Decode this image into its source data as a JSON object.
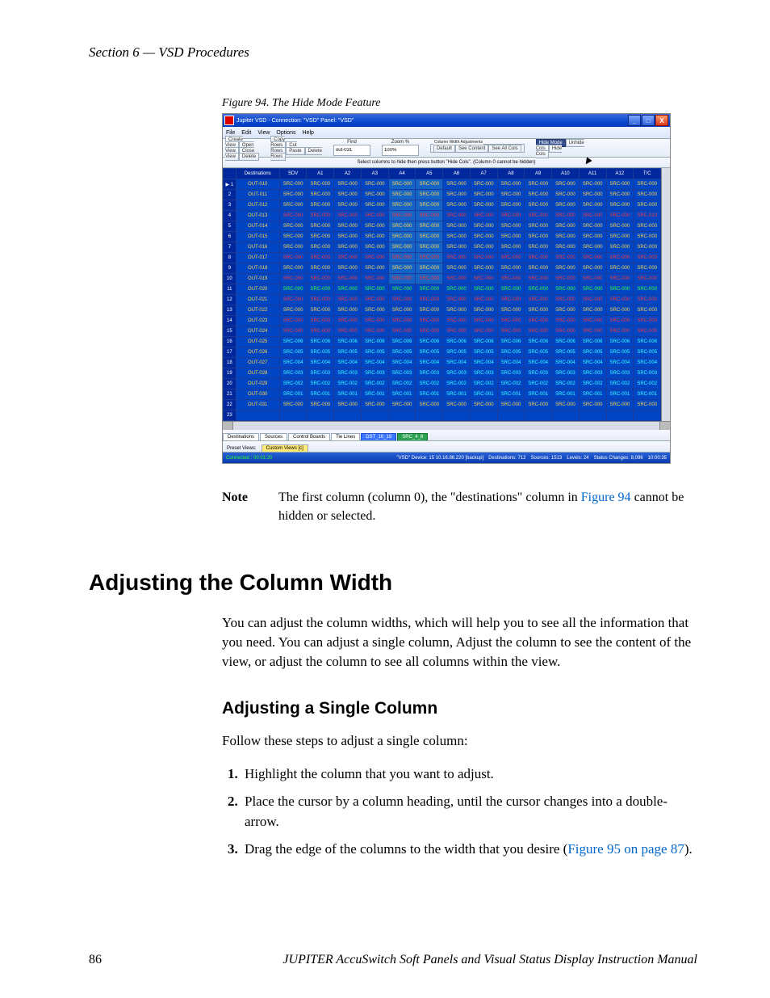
{
  "running_header": "Section 6 — VSD Procedures",
  "figure_caption": "Figure 94.  The Hide Mode Feature",
  "screenshot": {
    "window_title": "Jupiter VSD - Connection: \"VSD\"  Panel: \"VSD\"",
    "menu": [
      "File",
      "Edit",
      "View",
      "Options",
      "Help"
    ],
    "toolbar": {
      "btns_left": [
        "Create\nView",
        "Open\nView",
        "Close\nView",
        "Delete"
      ],
      "btns_row": [
        "Copy\nRows",
        "Cut\nRows",
        "Paste",
        "Delete\nRows"
      ],
      "find_label": "Find",
      "find_value": "out-031",
      "zoom_label": "Zoom %",
      "zoom_value": "100%",
      "cw_group_label": "Column Width Adjustments",
      "cw_btns": [
        "Default",
        "See Content",
        "See All Cols"
      ],
      "mode_btns": [
        "Hide Mode",
        "Unhide\nCols",
        "Hide\nCols"
      ]
    },
    "hint": "Select columns to hide then press button \"Hide Cols\". (Column 0 cannot be hidden)",
    "columns": [
      "",
      "Destinations",
      "SDV",
      "A1",
      "A2",
      "A3",
      "A4",
      "A5",
      "A6",
      "A7",
      "A8",
      "A9",
      "A10",
      "A11",
      "A12",
      "T/C"
    ],
    "rows": [
      {
        "n": 1,
        "dest": "OUT-010",
        "cell": "SRC-000",
        "style": "y",
        "sel": true,
        "a5sel": true
      },
      {
        "n": 2,
        "dest": "OUT-011",
        "cell": "SRC-000",
        "style": "y",
        "a5sel": true
      },
      {
        "n": 3,
        "dest": "OUT-012",
        "cell": "SRC-000",
        "style": "y",
        "a5sel": true
      },
      {
        "n": 4,
        "dest": "OUT-013",
        "cell": "SRC-000",
        "style": "r",
        "a5sel": true,
        "tc": "SRC-010"
      },
      {
        "n": 5,
        "dest": "OUT-014",
        "cell": "SRC-000",
        "style": "y",
        "a5sel": true
      },
      {
        "n": 6,
        "dest": "OUT-015",
        "cell": "SRC-000",
        "style": "y",
        "a5sel": true
      },
      {
        "n": 7,
        "dest": "OUT-016",
        "cell": "SRC-000",
        "style": "y",
        "a5sel": true
      },
      {
        "n": 8,
        "dest": "OUT-017",
        "cell": "SRC-000",
        "style": "r",
        "a5sel": true
      },
      {
        "n": 9,
        "dest": "OUT-018",
        "cell": "SRC-000",
        "style": "y",
        "a5sel": true
      },
      {
        "n": 10,
        "dest": "OUT-019",
        "cell": "SRC-000",
        "style": "r",
        "a5sel": true
      },
      {
        "n": 11,
        "dest": "OUT-020",
        "cell": "SRC-000",
        "style": "g"
      },
      {
        "n": 12,
        "dest": "OUT-021",
        "cell": "SRC-000",
        "style": "r"
      },
      {
        "n": 13,
        "dest": "OUT-022",
        "cell": "SRC-000",
        "style": "y"
      },
      {
        "n": 14,
        "dest": "OUT-023",
        "cell": "SRC-000",
        "style": "r"
      },
      {
        "n": 15,
        "dest": "OUT-024",
        "cell": "SRC-000",
        "style": "r"
      },
      {
        "n": 16,
        "dest": "OUT-025",
        "cell": "SRC-006",
        "style": "c"
      },
      {
        "n": 17,
        "dest": "OUT-026",
        "cell": "SRC-005",
        "style": "c"
      },
      {
        "n": 18,
        "dest": "OUT-027",
        "cell": "SRC-004",
        "style": "c"
      },
      {
        "n": 19,
        "dest": "OUT-028",
        "cell": "SRC-003",
        "style": "c"
      },
      {
        "n": 20,
        "dest": "OUT-029",
        "cell": "SRC-002",
        "style": "c"
      },
      {
        "n": 21,
        "dest": "OUT-030",
        "cell": "SRC-001",
        "style": "c"
      },
      {
        "n": 22,
        "dest": "OUT-031",
        "cell": "SRC-000",
        "style": "y"
      },
      {
        "n": 23,
        "dest": "",
        "cell": "",
        "style": "empty"
      }
    ],
    "tabs_top": [
      "Destinations",
      "Sources",
      "Control Boards",
      "Tie Lines",
      "DST_10_19",
      "SRC_4_8"
    ],
    "tabs_bottom_label": "Preset Views:",
    "tabs_bottom": [
      "Custom Views [c]"
    ],
    "status": {
      "connected": "Connected : 00:01:20",
      "device": "\"VSD\" Device: 15   10.16.86.220 [backup]",
      "dest": "Destinations:   712",
      "src": "Sources:  1513",
      "lvl": "Levels:   24",
      "chg": "Status Changes:          8,096",
      "time": "10:00:35"
    }
  },
  "note": {
    "label": "Note",
    "text_before": "The first column (column 0), the \"destinations\" column in ",
    "link": "Figure 94",
    "text_after": " cannot be hidden or selected."
  },
  "h1": "Adjusting the Column Width",
  "para1": "You can adjust the column widths, which will help you to see all the information that you need. You can adjust a single column, Adjust the column to see the content of the view, or adjust the column to see all columns within the view.",
  "h2": "Adjusting a Single Column",
  "para2": "Follow these steps to adjust a single column:",
  "steps": [
    {
      "t": "Highlight the column that you want to adjust."
    },
    {
      "t": "Place the cursor by a column heading, until the cursor changes into a double-arrow."
    },
    {
      "t_before": "Drag the edge of the columns to the width that you desire (",
      "link": "Figure 95 on page 87",
      "t_after": ")."
    }
  ],
  "footer": {
    "page": "86",
    "title": "JUPITER AccuSwitch Soft Panels and Visual Status Display Instruction Manual"
  }
}
